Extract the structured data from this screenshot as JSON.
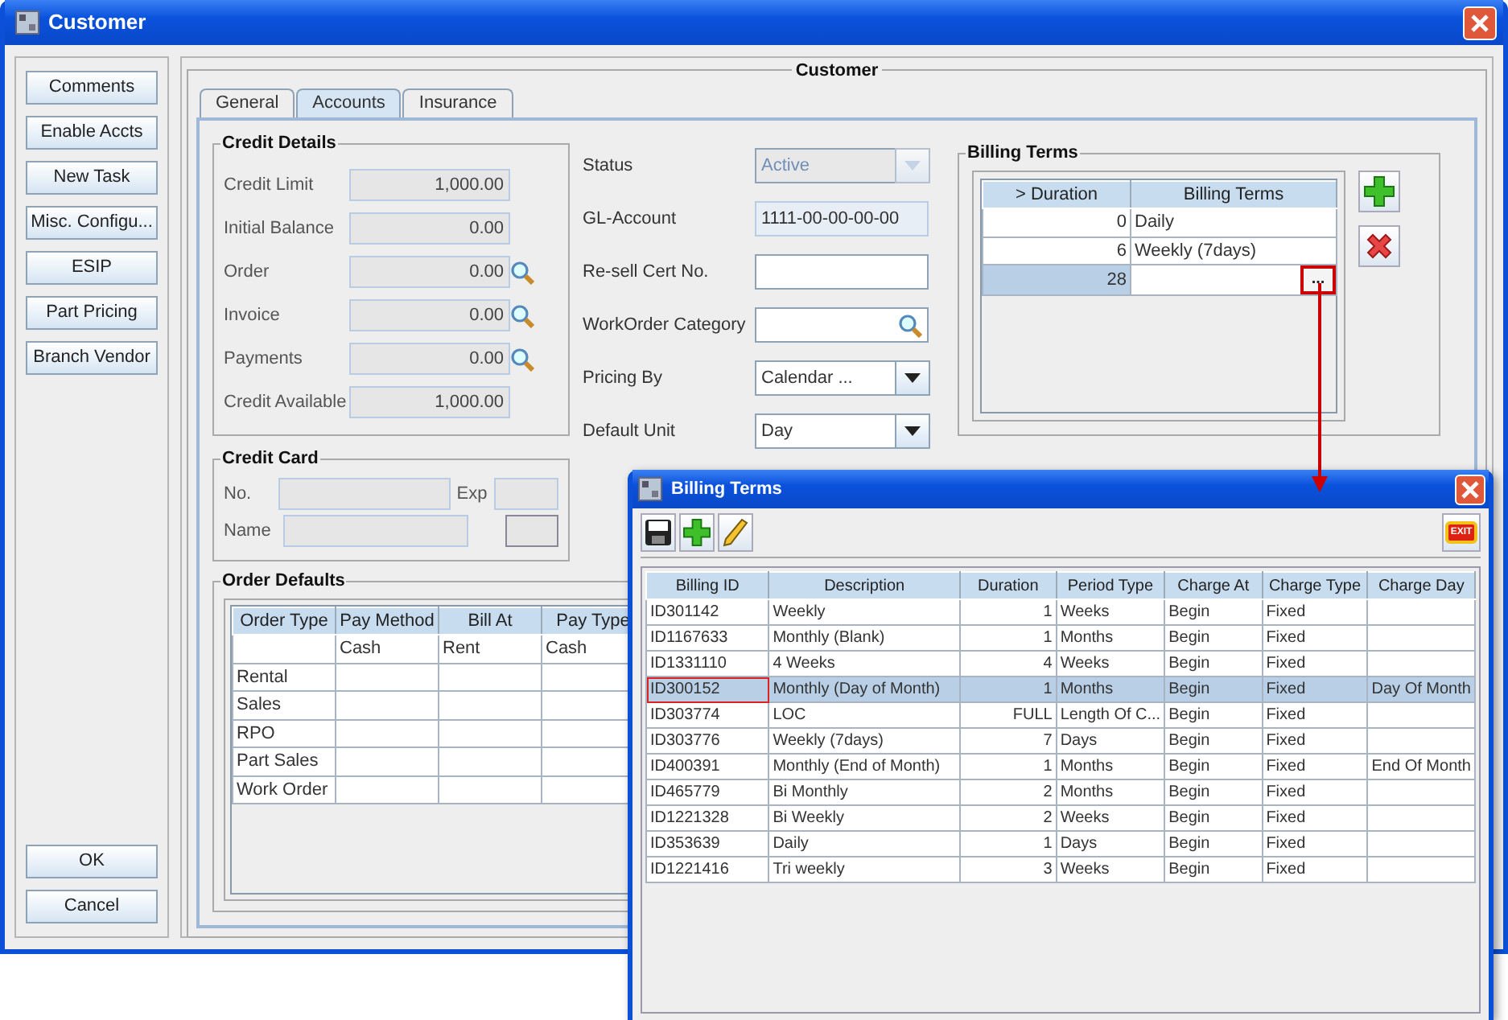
{
  "window": {
    "title": "Customer"
  },
  "side_buttons": [
    {
      "label": "Comments"
    },
    {
      "label": "Enable Accts"
    },
    {
      "label": "New Task"
    },
    {
      "label": "Misc. Configu..."
    },
    {
      "label": "ESIP"
    },
    {
      "label": "Part Pricing"
    },
    {
      "label": "Branch Vendor"
    }
  ],
  "bottom_buttons": [
    {
      "label": "OK"
    },
    {
      "label": "Cancel"
    }
  ],
  "group_title": "Customer",
  "tabs": [
    {
      "label": "General",
      "selected": false
    },
    {
      "label": "Accounts",
      "selected": true
    },
    {
      "label": "Insurance",
      "selected": false
    }
  ],
  "credit_details": {
    "title": "Credit Details",
    "fields": [
      {
        "label": "Credit Limit",
        "value": "1,000.00",
        "lookup": false
      },
      {
        "label": "Initial Balance",
        "value": "0.00",
        "lookup": false
      },
      {
        "label": "Order",
        "value": "0.00",
        "lookup": true
      },
      {
        "label": "Invoice",
        "value": "0.00",
        "lookup": true
      },
      {
        "label": "Payments",
        "value": "0.00",
        "lookup": true
      },
      {
        "label": "Credit Available",
        "value": "1,000.00",
        "lookup": false
      }
    ]
  },
  "credit_card": {
    "title": "Credit Card",
    "number_label": "No.",
    "name_label": "Name",
    "exp_label": "Exp"
  },
  "account_fields": [
    {
      "label": "Status",
      "kind": "combo",
      "value": "Active",
      "disabled": true
    },
    {
      "label": "GL-Account",
      "kind": "text",
      "value": "1111-00-00-00-00",
      "disabled": false,
      "readonly": true
    },
    {
      "label": "Re-sell Cert No.",
      "kind": "text",
      "disabled": false,
      "readonly": false
    },
    {
      "label": "WorkOrder Category",
      "kind": "search",
      "disabled": false
    },
    {
      "label": "Pricing By",
      "kind": "combo",
      "value": "Calendar ...",
      "disabled": false
    },
    {
      "label": "Default Unit",
      "kind": "combo",
      "value": "Day",
      "disabled": false
    }
  ],
  "billing_terms": {
    "title": "Billing Terms",
    "columns": [
      "> Duration",
      "Billing Terms"
    ],
    "rows": [
      {
        "duration": "0",
        "term": "Daily",
        "selected": false,
        "editing": false
      },
      {
        "duration": "6",
        "term": "Weekly (7days)",
        "selected": false,
        "editing": false
      },
      {
        "duration": "28",
        "selected": true,
        "editing": true,
        "button": "..."
      }
    ]
  },
  "order_defaults": {
    "title": "Order Defaults",
    "columns": [
      "Order Type",
      "Pay Method",
      "Bill At",
      "Pay Type"
    ],
    "rows": [
      [
        "",
        "Cash",
        "Rent",
        "Cash"
      ],
      [
        "Rental",
        "",
        "",
        ""
      ],
      [
        "Sales",
        "",
        "",
        ""
      ],
      [
        "RPO",
        "",
        "",
        ""
      ],
      [
        "Part Sales",
        "",
        "",
        ""
      ],
      [
        "Work Order",
        "",
        "",
        ""
      ]
    ]
  },
  "popup": {
    "title": "Billing Terms",
    "exit_label": "EXIT",
    "columns": [
      "Billing ID",
      "Description",
      "Duration",
      "Period Type",
      "Charge At",
      "Charge Type",
      "Charge Day"
    ],
    "rows": [
      {
        "cells": [
          "ID301142",
          "Weekly",
          "1",
          "Weeks",
          "Begin",
          "Fixed",
          ""
        ],
        "selected": false,
        "focused": false
      },
      {
        "cells": [
          "ID1167633",
          "Monthly (Blank)",
          "1",
          "Months",
          "Begin",
          "Fixed",
          ""
        ],
        "selected": false,
        "focused": false
      },
      {
        "cells": [
          "ID1331110",
          "4 Weeks",
          "4",
          "Weeks",
          "Begin",
          "Fixed",
          ""
        ],
        "selected": false,
        "focused": false
      },
      {
        "cells": [
          "ID300152",
          "Monthly (Day of Month)",
          "1",
          "Months",
          "Begin",
          "Fixed",
          "Day Of Month"
        ],
        "selected": true,
        "focused": true
      },
      {
        "cells": [
          "ID303774",
          "LOC",
          "FULL",
          "Length Of C...",
          "Begin",
          "Fixed",
          ""
        ],
        "selected": false,
        "focused": false
      },
      {
        "cells": [
          "ID303776",
          "Weekly (7days)",
          "7",
          "Days",
          "Begin",
          "Fixed",
          ""
        ],
        "selected": false,
        "focused": false
      },
      {
        "cells": [
          "ID400391",
          "Monthly (End of Month)",
          "1",
          "Months",
          "Begin",
          "Fixed",
          "End Of Month"
        ],
        "selected": false,
        "focused": false
      },
      {
        "cells": [
          "ID465779",
          "Bi Monthly",
          "2",
          "Months",
          "Begin",
          "Fixed",
          ""
        ],
        "selected": false,
        "focused": false
      },
      {
        "cells": [
          "ID1221328",
          "Bi Weekly",
          "2",
          "Weeks",
          "Begin",
          "Fixed",
          ""
        ],
        "selected": false,
        "focused": false
      },
      {
        "cells": [
          "ID353639",
          "Daily",
          "1",
          "Days",
          "Begin",
          "Fixed",
          ""
        ],
        "selected": false,
        "focused": false
      },
      {
        "cells": [
          "ID1221416",
          "Tri weekly",
          "3",
          "Weeks",
          "Begin",
          "Fixed",
          ""
        ],
        "selected": false,
        "focused": false
      }
    ]
  }
}
